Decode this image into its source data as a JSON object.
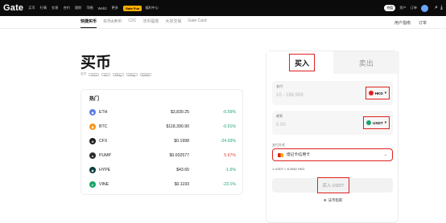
{
  "topnav": {
    "logo": "Gate",
    "items": [
      "买币",
      "行情",
      "交易",
      "合约",
      "理财",
      "币圈",
      "Web3",
      "更多"
    ],
    "promo": "Gate Fun",
    "sub_item": "福利中心",
    "right": {
      "pill": "充值",
      "items": [
        "资产",
        "订单"
      ]
    }
  },
  "subnav": {
    "tabs": [
      "快捷买币",
      "买币&卖币",
      "C2C",
      "法币提现",
      "大宗交易",
      "Gate Card"
    ],
    "right": [
      "用户指南",
      "订单"
    ]
  },
  "page": {
    "title": "买币",
    "pay_label": "支付",
    "pay_methods": [
      "VISA",
      "MC",
      "APay",
      "GPay",
      "BANK"
    ]
  },
  "hot": {
    "title": "热门",
    "rows": [
      {
        "symbol": "ETH",
        "price": "$3,830.25",
        "change": "-0.59%",
        "color": "#627eea",
        "dir": "up"
      },
      {
        "symbol": "BTC",
        "price": "$118,390.90",
        "change": "-0.51%",
        "color": "#f7931a",
        "dir": "up"
      },
      {
        "symbol": "CFX",
        "price": "$0.1998",
        "change": "-24.93%",
        "color": "#1c1c1c",
        "dir": "up"
      },
      {
        "symbol": "PUMP",
        "price": "$0.002577",
        "change": "5.67%",
        "color": "#2b2b2b",
        "dir": "down"
      },
      {
        "symbol": "HYPE",
        "price": "$43.65",
        "change": "-1.6%",
        "color": "#0b3b3b",
        "dir": "up"
      },
      {
        "symbol": "VINE",
        "price": "$0.1193",
        "change": "-23.1%",
        "color": "#1aa36b",
        "dir": "up"
      }
    ]
  },
  "trade": {
    "buy_tab": "买入",
    "sell_tab": "卖出",
    "pay_field": {
      "label": "支付",
      "placeholder": "10 - 186,999",
      "currency": "HKD"
    },
    "receive_field": {
      "label": "收到",
      "placeholder": "0.00",
      "currency": "USDT"
    },
    "method_label": "支付方式",
    "method_value": "借记卡/信用卡",
    "rate_text": "1 USDT ≈ 8.2582 HKD",
    "buy_button": "买入 USDT",
    "help": "法币指南"
  },
  "colors": {
    "accent": "#1aa36b",
    "negative": "#e03b3b",
    "highlight": "#e02020"
  }
}
